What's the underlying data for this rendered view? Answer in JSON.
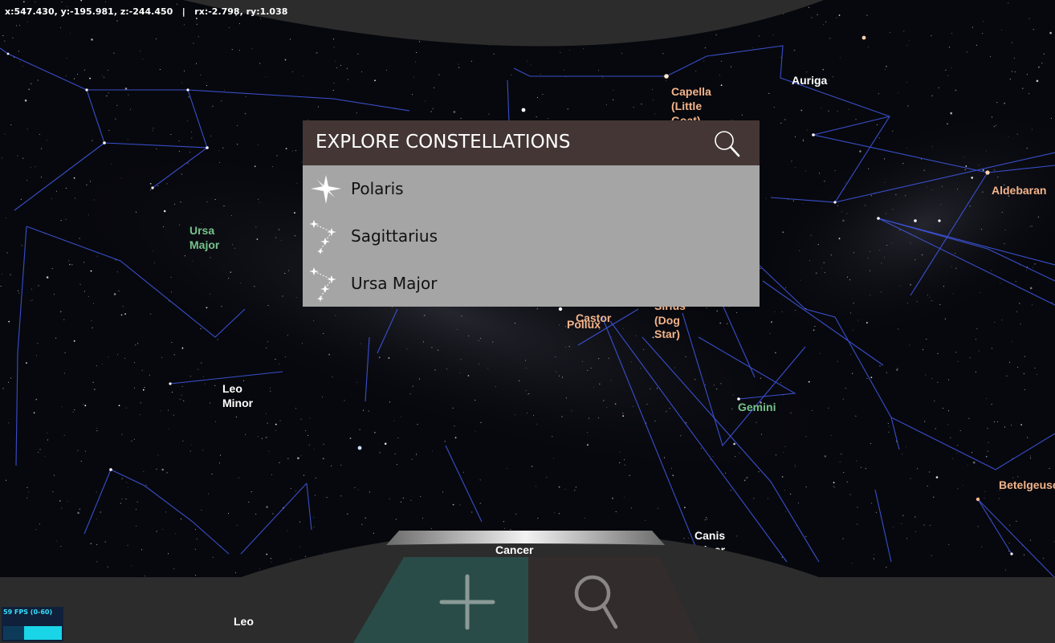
{
  "coords_text": "x:547.430, y:-195.981, z:-244.450   |   rx:-2.798, ry:1.038",
  "panel": {
    "title": "EXPLORE CONSTELLATIONS",
    "items": [
      {
        "label": "Polaris",
        "icon": "star-icon"
      },
      {
        "label": "Sagittarius",
        "icon": "constellation-icon"
      },
      {
        "label": "Ursa Major",
        "icon": "constellation-icon"
      }
    ]
  },
  "constellation_labels": {
    "ursa_major": [
      "Ursa",
      "Major"
    ],
    "leo_minor": [
      "Leo",
      "Minor"
    ],
    "auriga": "Auriga",
    "gemini": "Gemini",
    "canis_minor": [
      "Canis",
      "Minor"
    ],
    "cancer": "Cancer",
    "leo": "Leo"
  },
  "star_labels": {
    "capella": [
      "Capella",
      "(Little",
      "Goat)"
    ],
    "aldebaran": "Aldebaran",
    "castor": "Castor",
    "pollux": "Pollux",
    "sirius": [
      "Sirius",
      "(Dog",
      "Star)"
    ],
    "betelgeuse": "Betelgeuse"
  },
  "fps": {
    "text": "59 FPS (0-60)",
    "value": 59
  },
  "colors": {
    "constellation_line": "#3f56e0",
    "constellation_label": "#ffffff",
    "highlight_constellation": "#76c28a",
    "star_label": "#f3b48a",
    "panel_header": "#433634",
    "panel_body": "#a5a5a5",
    "add_tab": "#2a4c48",
    "search_tab": "#332c2d",
    "dome": "#2c2c2c"
  },
  "controls": {
    "add_icon": "plus-icon",
    "search_icon": "search-icon"
  }
}
